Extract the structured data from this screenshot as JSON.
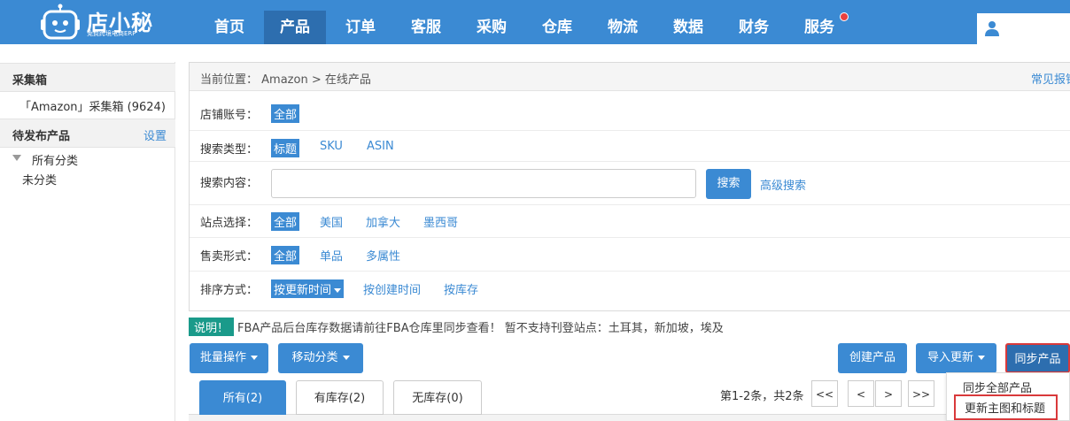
{
  "colors": {
    "nav_bg": "#3b8ad3",
    "nav_active": "#2d6eaf",
    "accent": "#3b8ad3",
    "highlight_border": "#d9393b",
    "notice_badge": "#1a9a8a"
  },
  "header": {
    "logo_title": "店小秘",
    "logo_subtitle": "免费跨境电商ERP",
    "nav": [
      "首页",
      "产品",
      "订单",
      "客服",
      "采购",
      "仓库",
      "物流",
      "数据",
      "财务",
      "服务"
    ],
    "active_nav": "产品"
  },
  "sidebar": {
    "section1_title": "采集箱",
    "collect_item": "「Amazon」采集箱 (9624)",
    "section2_title": "待发布产品",
    "settings_link": "设置",
    "all_category": "所有分类",
    "uncategorized": "未分类"
  },
  "breadcrumb": {
    "prefix": "当前位置：",
    "path": "Amazon > 在线产品",
    "faq": "常见报错"
  },
  "filters": {
    "account": {
      "label": "店铺账号：",
      "options": [
        "全部"
      ]
    },
    "search_type": {
      "label": "搜索类型：",
      "options": [
        "标题",
        "SKU",
        "ASIN"
      ]
    },
    "search_content": {
      "label": "搜索内容：",
      "value": "",
      "button": "搜索",
      "advanced": "高级搜索"
    },
    "site": {
      "label": "站点选择：",
      "options": [
        "全部",
        "美国",
        "加拿大",
        "墨西哥"
      ]
    },
    "sell_form": {
      "label": "售卖形式：",
      "options": [
        "全部",
        "单品",
        "多属性"
      ]
    },
    "sort": {
      "label": "排序方式：",
      "options": [
        "按更新时间",
        "按创建时间",
        "按库存"
      ]
    }
  },
  "notice": {
    "badge": "说明！",
    "text": "FBA产品后台库存数据请前往FBA仓库里同步查看！ 暂不支持刊登站点：土耳其，新加坡，埃及"
  },
  "actions": {
    "batch": "批量操作",
    "move_category": "移动分类",
    "create": "创建产品",
    "import_update": "导入更新",
    "sync": "同步产品"
  },
  "tabs": [
    "所有(2)",
    "有库存(2)",
    "无库存(0)"
  ],
  "pager": {
    "summary": "第1-2条，共2条",
    "buttons": [
      "<<",
      "<",
      ">",
      ">>"
    ]
  },
  "sync_menu": [
    "同步全部产品",
    "更新主图和标题"
  ]
}
